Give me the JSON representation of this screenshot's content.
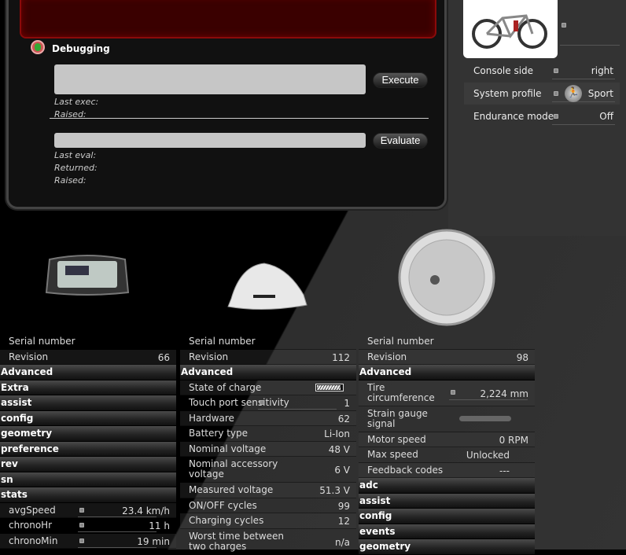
{
  "debug": {
    "title": "Debugging",
    "execute": "Execute",
    "evaluate": "Evaluate",
    "last_exec": "Last exec:",
    "raised": "Raised:",
    "last_eval": "Last eval:",
    "returned": "Returned:",
    "raised2": "Raised:"
  },
  "settings": [
    {
      "label": "Console side",
      "value": "right"
    },
    {
      "label": "System profile",
      "value": "Sport",
      "icon": "runner-icon"
    },
    {
      "label": "Endurance mode",
      "value": "Off"
    }
  ],
  "columns": [
    {
      "name": "console",
      "rows": [
        {
          "label": "Serial number",
          "value": ""
        },
        {
          "label": "Revision",
          "value": "66"
        },
        {
          "header": "Advanced"
        },
        {
          "header": "Extra"
        },
        {
          "header": "assist"
        },
        {
          "header": "config"
        },
        {
          "header": "geometry"
        },
        {
          "header": "preference"
        },
        {
          "header": "rev"
        },
        {
          "header": "sn"
        },
        {
          "header": "stats"
        },
        {
          "label": "avgSpeed",
          "value": "23.4 km/h",
          "slider": true
        },
        {
          "label": "chronoHr",
          "value": "11 h",
          "slider": true
        },
        {
          "label": "chronoMin",
          "value": "19 min",
          "slider": true
        }
      ]
    },
    {
      "name": "battery",
      "rows": [
        {
          "label": "Serial number",
          "value": ""
        },
        {
          "label": "Revision",
          "value": "112"
        },
        {
          "header": "Advanced"
        },
        {
          "label": "State of charge",
          "value": "",
          "battery": 0.95
        },
        {
          "label": "Touch port sensitivity",
          "value": "1",
          "slider": true
        },
        {
          "label": "Hardware",
          "value": "62"
        },
        {
          "label": "Battery type",
          "value": "Li-Ion"
        },
        {
          "label": "Nominal voltage",
          "value": "48 V"
        },
        {
          "label": "Nominal accessory voltage",
          "value": "6 V",
          "tall": true
        },
        {
          "label": "Measured voltage",
          "value": "51.3 V"
        },
        {
          "label": "ON/OFF cycles",
          "value": "99"
        },
        {
          "label": "Charging cycles",
          "value": "12"
        },
        {
          "label": "Worst time between two charges",
          "value": "n/a",
          "tall": true
        }
      ]
    },
    {
      "name": "motor",
      "rows": [
        {
          "label": "Serial number",
          "value": ""
        },
        {
          "label": "Revision",
          "value": "98"
        },
        {
          "header": "Advanced"
        },
        {
          "label": "Tire circumference",
          "value": "2,224 mm",
          "slider": true,
          "tall": true
        },
        {
          "label": "Strain gauge signal",
          "value": "",
          "gauge": true,
          "tall": true
        },
        {
          "label": "Motor speed",
          "value": "0 RPM"
        },
        {
          "label": "Max speed",
          "value": "Unlocked"
        },
        {
          "label": "Feedback codes",
          "value": "---"
        },
        {
          "header": "adc"
        },
        {
          "header": "assist"
        },
        {
          "header": "config"
        },
        {
          "header": "events"
        },
        {
          "header": "geometry"
        }
      ]
    }
  ]
}
